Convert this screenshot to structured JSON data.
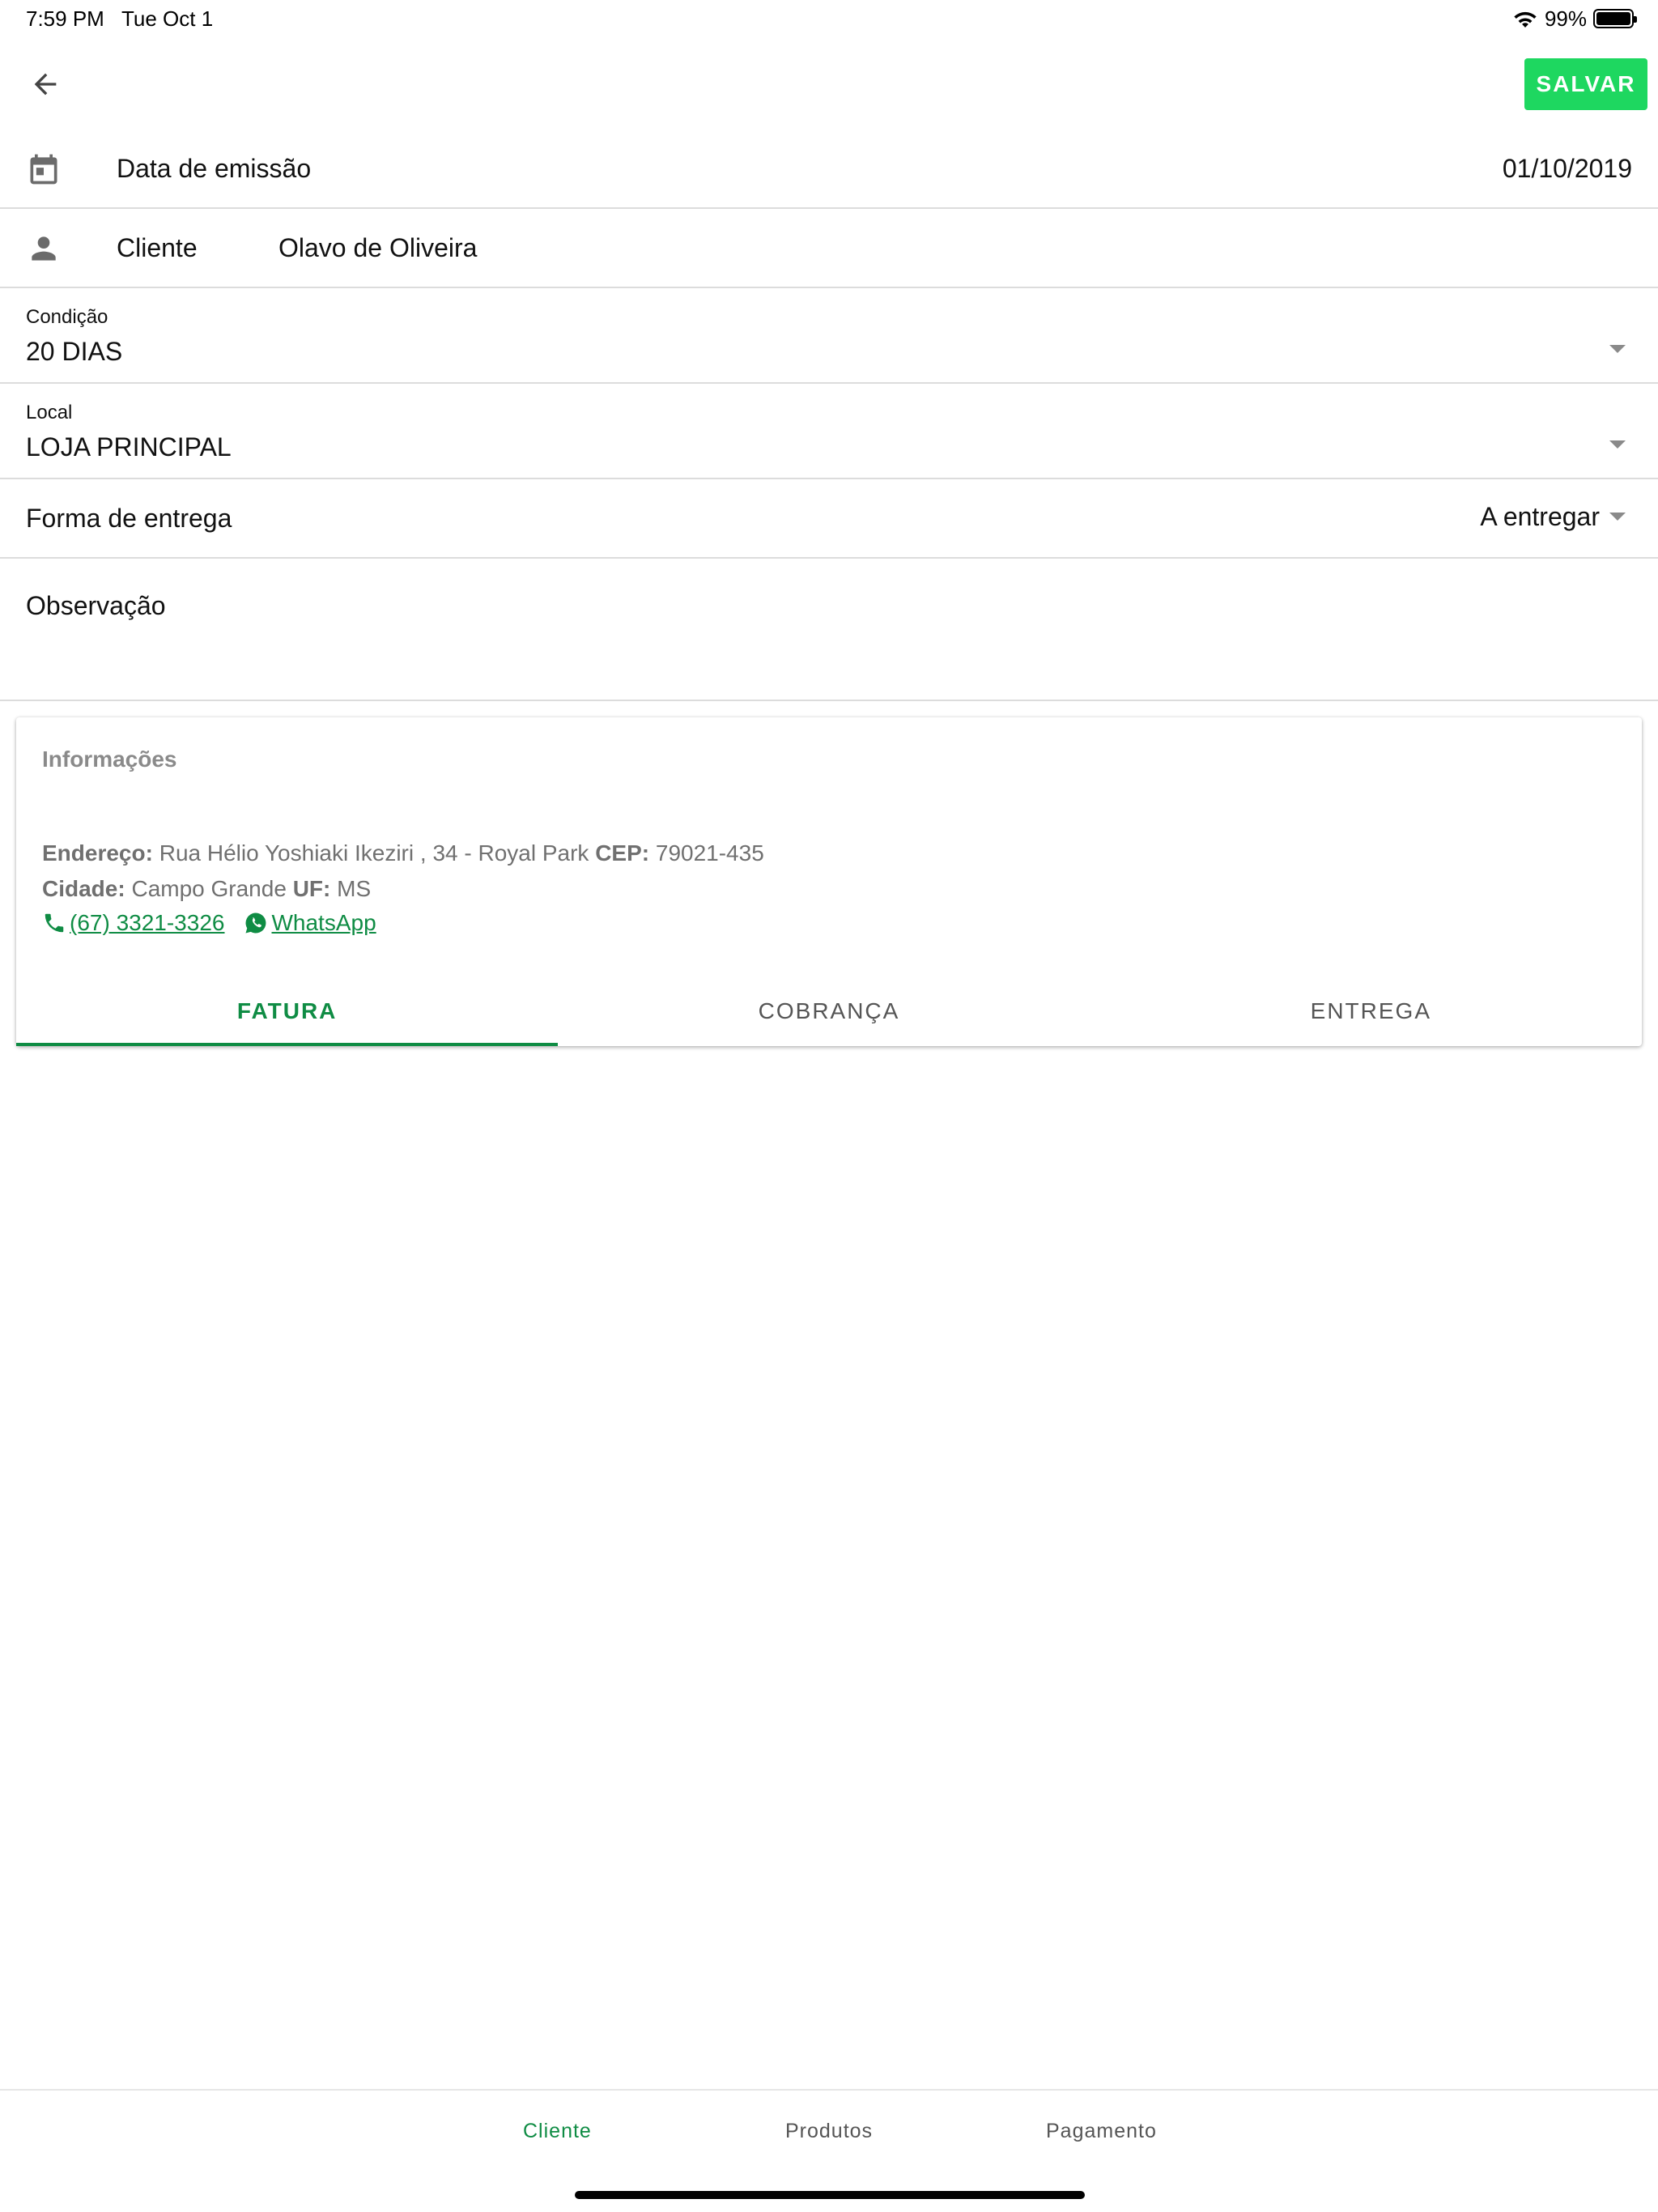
{
  "status_bar": {
    "time": "7:59 PM",
    "date": "Tue Oct 1",
    "battery_pct": "99%",
    "battery_level": 0.99
  },
  "toolbar": {
    "back_icon": "arrow-left-icon",
    "save_label": "SALVAR",
    "save_color": "#1ed760"
  },
  "form": {
    "emission": {
      "label": "Data de emissão",
      "value": "01/10/2019",
      "icon": "calendar-icon"
    },
    "client": {
      "label": "Cliente",
      "value": "Olavo de Oliveira",
      "icon": "person-icon"
    },
    "condition": {
      "label": "Condição",
      "value": "20 DIAS"
    },
    "local": {
      "label": "Local",
      "value": "LOJA PRINCIPAL"
    },
    "delivery": {
      "label": "Forma de entrega",
      "value": "A entregar"
    },
    "observation": {
      "label": "Observação"
    }
  },
  "info_card": {
    "title": "Informações",
    "address_label": "Endereço:",
    "address": "Rua Hélio Yoshiaki Ikeziri , 34 - Royal Park",
    "cep_label": "CEP:",
    "cep": "79021-435",
    "city_label": "Cidade:",
    "city": "Campo Grande",
    "uf_label": "UF:",
    "uf": "MS",
    "phone": "(67) 3321-3326",
    "whatsapp": "WhatsApp",
    "tabs": [
      {
        "label": "FATURA",
        "active": true
      },
      {
        "label": "COBRANÇA",
        "active": false
      },
      {
        "label": "ENTREGA",
        "active": false
      }
    ]
  },
  "bottom_nav": {
    "items": [
      {
        "label": "Cliente",
        "active": true
      },
      {
        "label": "Produtos",
        "active": false
      },
      {
        "label": "Pagamento",
        "active": false
      }
    ]
  },
  "colors": {
    "accent_green": "#0f8c44",
    "save_green": "#1ed760",
    "divider": "#dcdcdc"
  }
}
